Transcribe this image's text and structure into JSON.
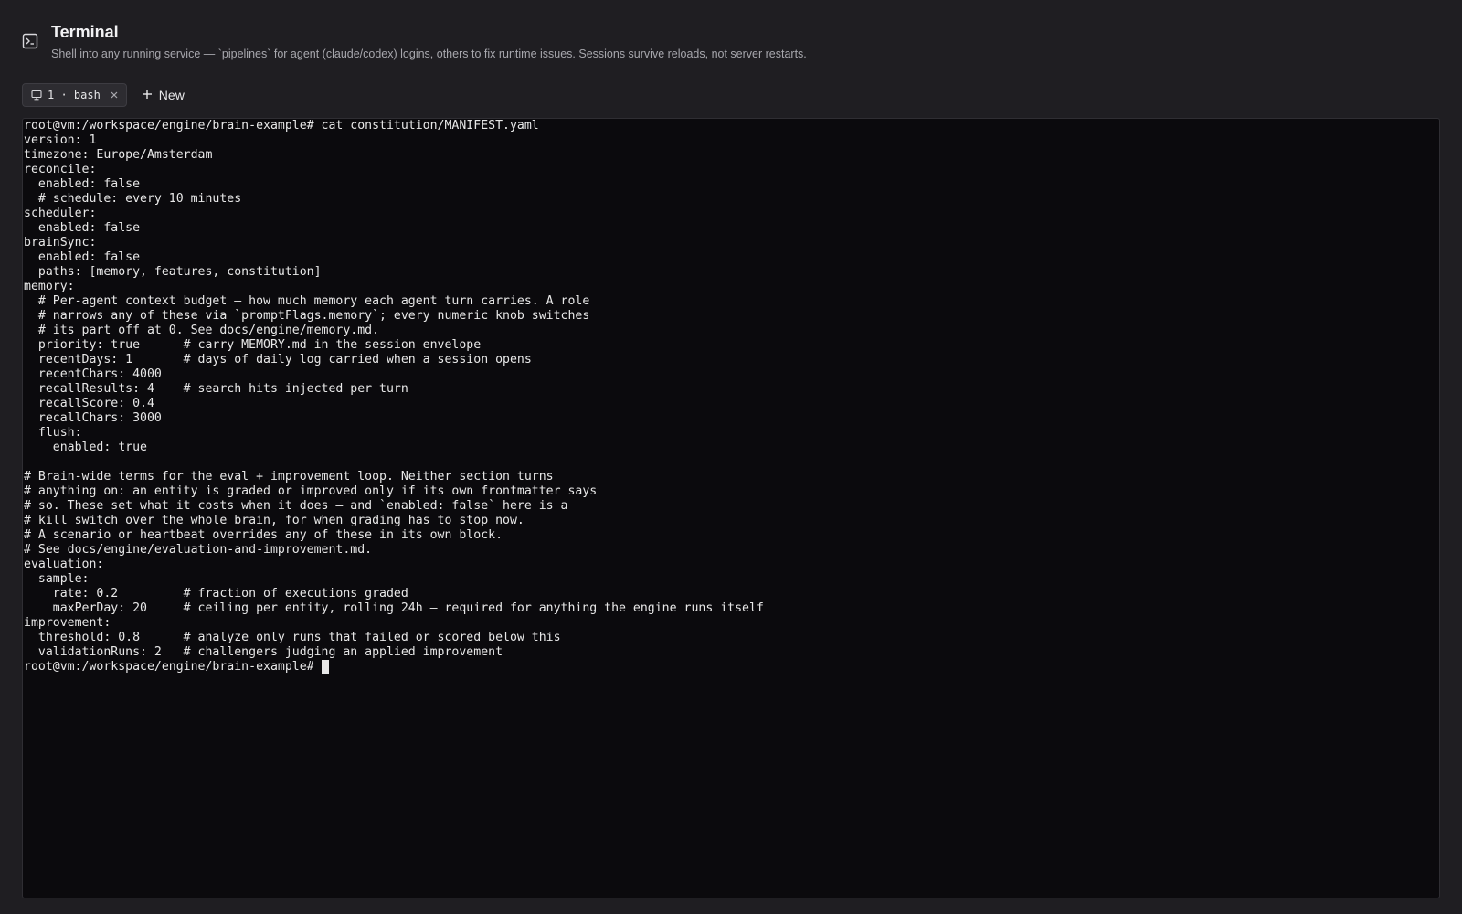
{
  "header": {
    "icon": "terminal-icon",
    "title": "Terminal",
    "subtitle": "Shell into any running service — `pipelines` for agent (claude/codex) logins, others to fix runtime issues. Sessions survive reloads, not server restarts."
  },
  "tabs": [
    {
      "label": "1 · bash",
      "icon": "monitor-icon",
      "active": true
    }
  ],
  "new_button": {
    "label": "New",
    "icon": "plus-icon"
  },
  "terminal": {
    "lines": [
      "root@vm:/workspace/engine/brain-example# cat constitution/MANIFEST.yaml",
      "version: 1",
      "timezone: Europe/Amsterdam",
      "reconcile:",
      "  enabled: false",
      "  # schedule: every 10 minutes",
      "scheduler:",
      "  enabled: false",
      "brainSync:",
      "  enabled: false",
      "  paths: [memory, features, constitution]",
      "memory:",
      "  # Per-agent context budget — how much memory each agent turn carries. A role",
      "  # narrows any of these via `promptFlags.memory`; every numeric knob switches",
      "  # its part off at 0. See docs/engine/memory.md.",
      "  priority: true      # carry MEMORY.md in the session envelope",
      "  recentDays: 1       # days of daily log carried when a session opens",
      "  recentChars: 4000",
      "  recallResults: 4    # search hits injected per turn",
      "  recallScore: 0.4",
      "  recallChars: 3000",
      "  flush:",
      "    enabled: true",
      "",
      "# Brain-wide terms for the eval + improvement loop. Neither section turns",
      "# anything on: an entity is graded or improved only if its own frontmatter says",
      "# so. These set what it costs when it does — and `enabled: false` here is a",
      "# kill switch over the whole brain, for when grading has to stop now.",
      "# A scenario or heartbeat overrides any of these in its own block.",
      "# See docs/engine/evaluation-and-improvement.md.",
      "evaluation:",
      "  sample:",
      "    rate: 0.2         # fraction of executions graded",
      "    maxPerDay: 20     # ceiling per entity, rolling 24h — required for anything the engine runs itself",
      "improvement:",
      "  threshold: 0.8      # analyze only runs that failed or scored below this",
      "  validationRuns: 2   # challengers judging an applied improvement"
    ],
    "prompt": "root@vm:/workspace/engine/brain-example#"
  }
}
